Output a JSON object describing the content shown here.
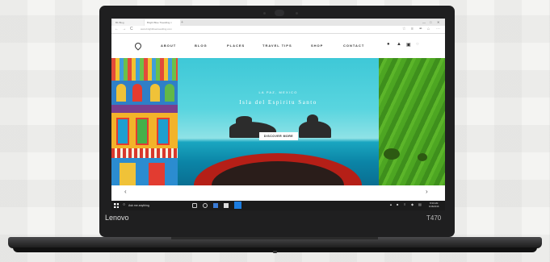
{
  "browser": {
    "tabs": [
      {
        "label": "B1 Blog"
      },
      {
        "label": "Bright Blue Travelling ×"
      }
    ],
    "new_tab": "+",
    "window_controls": [
      "—",
      "□",
      "✕"
    ],
    "url": "www.brightbluetravelling.com",
    "nav": {
      "back": "←",
      "forward": "→",
      "refresh": "C"
    },
    "toolbar": [
      "☆",
      "≡",
      "✒",
      "⌂",
      "⋯"
    ]
  },
  "site": {
    "nav": [
      {
        "label": "ABOUT"
      },
      {
        "label": "BLOG"
      },
      {
        "label": "PLACES"
      },
      {
        "label": "TRAVEL TIPS"
      },
      {
        "label": "SHOP"
      },
      {
        "label": "CONTACT"
      }
    ],
    "social": [
      "●",
      "▲",
      "▣",
      "○"
    ],
    "hero": {
      "kicker": "LA PAZ, MEXICO",
      "title": "Isla del Espiritu Santo",
      "cta": "DISCOVER MORE"
    },
    "slider": {
      "prev": "‹",
      "next": "›"
    }
  },
  "taskbar": {
    "search_placeholder": "Ask me anything",
    "search_icon": "○",
    "tray_icons": [
      "▲",
      "■",
      "≡",
      "◆",
      "▤"
    ],
    "time": "8:30 AM",
    "date": "6/18/2016"
  },
  "device": {
    "brand": "Lenovo",
    "model": "T470"
  },
  "colors": {
    "accent": "#1c7de0",
    "sea": "#2ab7c9",
    "boat": "#b51f17",
    "grass": "#4da622"
  }
}
